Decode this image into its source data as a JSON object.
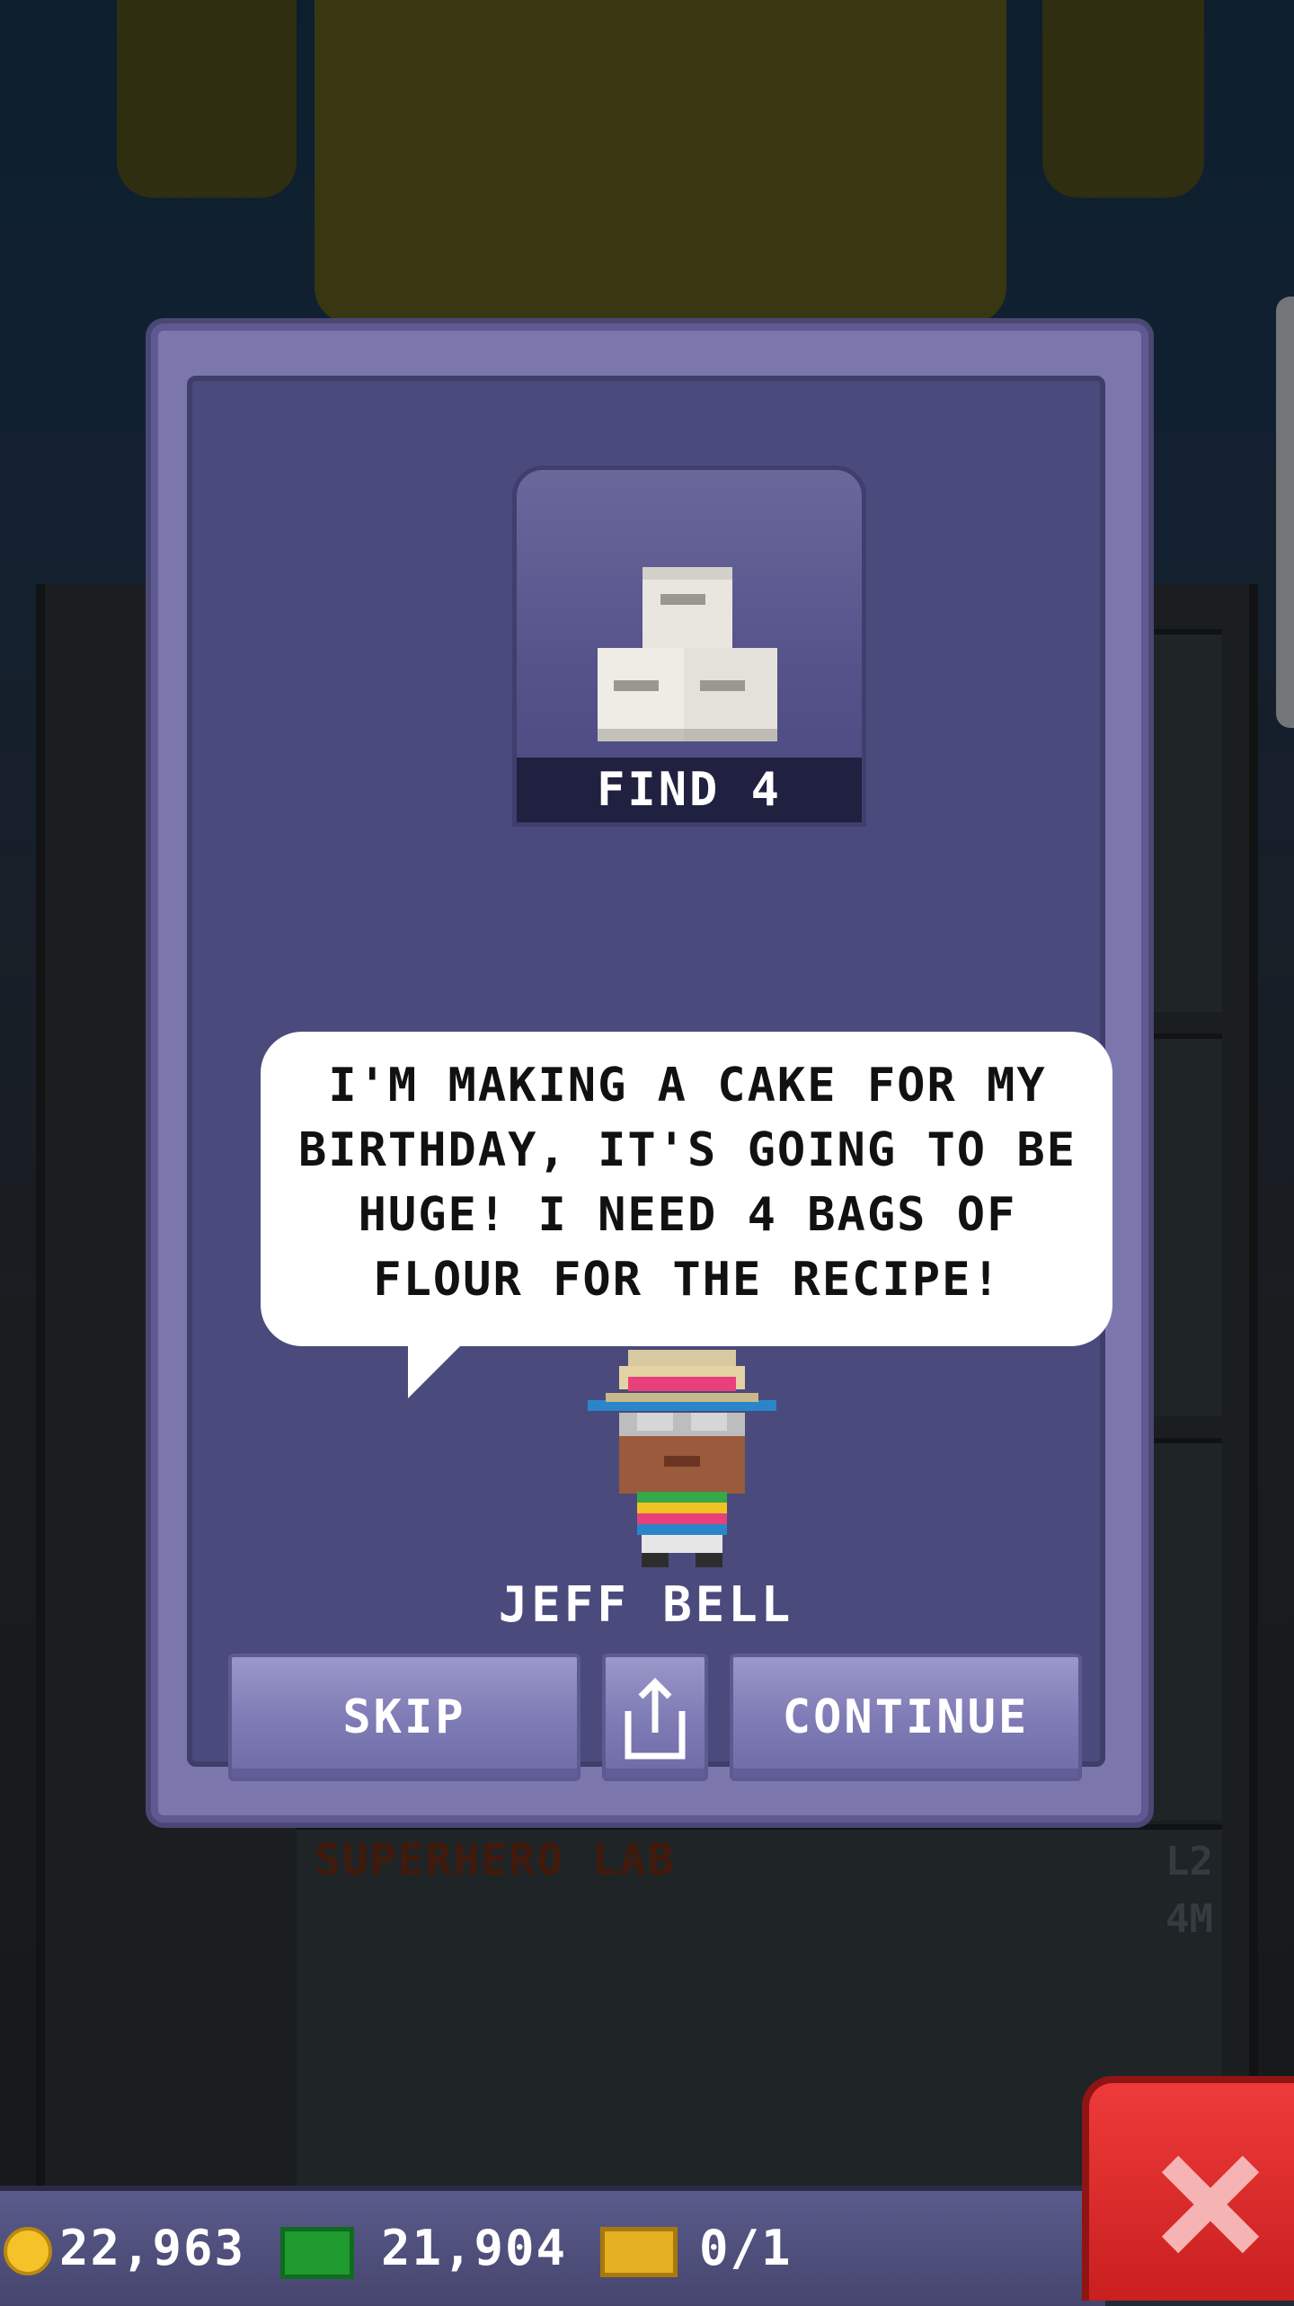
{
  "quest": {
    "item_name": "flour",
    "find_label": "FIND 4",
    "dialogue": "I'M MAKING A CAKE FOR MY BIRTHDAY, IT'S GOING TO BE HUGE! I NEED 4 BAGS OF FLOUR FOR THE RECIPE!",
    "character_name": "JEFF BELL"
  },
  "buttons": {
    "skip_label": "SKIP",
    "continue_label": "CONTINUE",
    "share_icon": "share-icon"
  },
  "background": {
    "floor_title": "SUPERHERO LAB",
    "floor_level": "L2",
    "floor_cost": "4M"
  },
  "status_bar": {
    "coins": "22,963",
    "bux": "21,904",
    "tickets": "0/1"
  },
  "colors": {
    "dialog": "#7b77ad",
    "dialog_inner": "#4b4a7d",
    "button": "#7f7cb6",
    "close": "#e32a2a"
  }
}
